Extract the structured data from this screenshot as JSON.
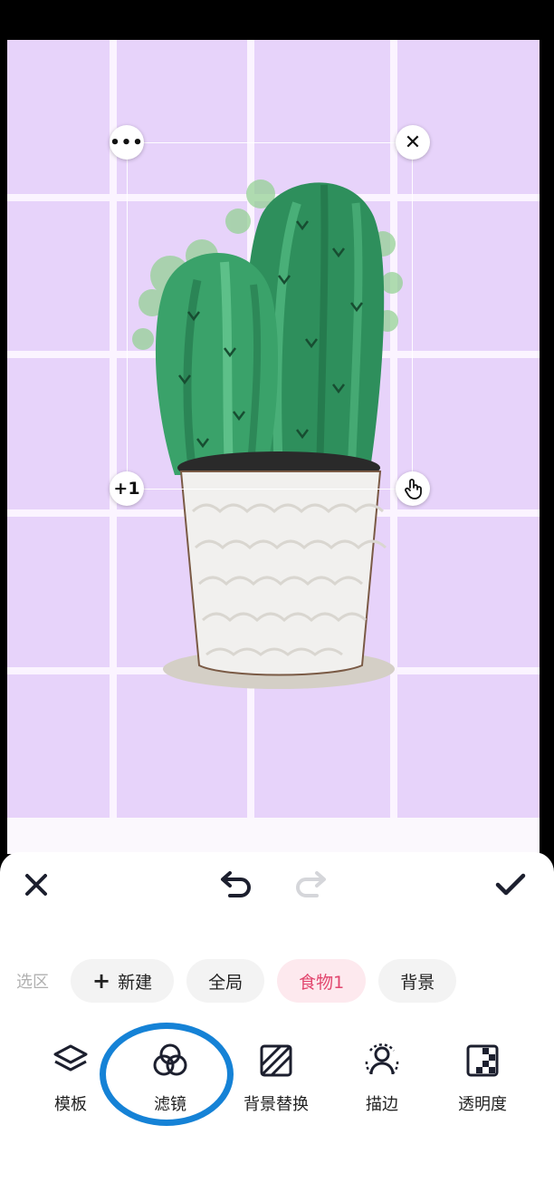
{
  "canvas": {
    "handles": {
      "more": "•••",
      "close": "✕",
      "add": "+1",
      "drag": "hand-icon"
    }
  },
  "toolbar": {
    "close_icon": "close-icon",
    "undo_icon": "undo-icon",
    "redo_icon": "redo-icon",
    "confirm_icon": "check-icon"
  },
  "selection": {
    "label": "选区",
    "chips": [
      {
        "label": "新建",
        "icon": "plus-icon"
      },
      {
        "label": "全局"
      },
      {
        "label": "食物1",
        "active": true
      },
      {
        "label": "背景"
      }
    ]
  },
  "tools": [
    {
      "label": "模板",
      "icon": "layers-icon"
    },
    {
      "label": "滤镜",
      "icon": "filter-circles-icon",
      "highlighted": true
    },
    {
      "label": "背景替换",
      "icon": "background-replace-icon"
    },
    {
      "label": "描边",
      "icon": "outline-person-icon"
    },
    {
      "label": "透明度",
      "icon": "opacity-icon"
    }
  ],
  "colors": {
    "accent": "#e2466e",
    "highlight": "#1582d6",
    "tile": "#e7d3fa"
  }
}
